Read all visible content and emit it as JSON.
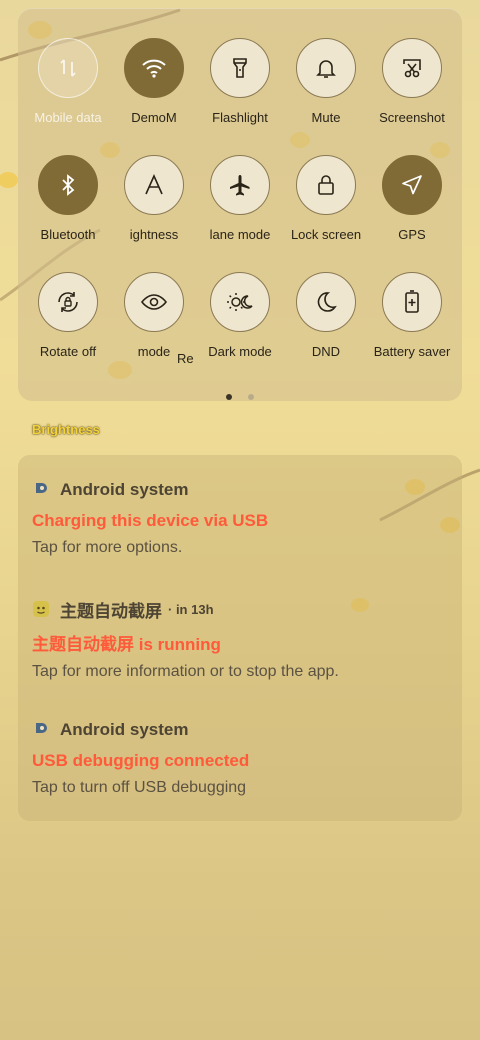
{
  "quick_settings": {
    "tiles": [
      {
        "label": "Mobile data",
        "icon": "mobile-data-icon",
        "state": "disabled"
      },
      {
        "label": "DemoM",
        "icon": "wifi-icon",
        "state": "on"
      },
      {
        "label": "Flashlight",
        "icon": "flashlight-icon",
        "state": "off"
      },
      {
        "label": "Mute",
        "icon": "bell-icon",
        "state": "off"
      },
      {
        "label": "Screenshot",
        "icon": "screenshot-icon",
        "state": "off"
      },
      {
        "label": "Bluetooth",
        "icon": "bluetooth-icon",
        "state": "on"
      },
      {
        "label": "ightness",
        "icon": "auto-brightness-icon",
        "state": "off"
      },
      {
        "label": "lane mode",
        "icon": "airplane-icon",
        "state": "off"
      },
      {
        "label": "Lock screen",
        "icon": "lock-icon",
        "state": "off"
      },
      {
        "label": "GPS",
        "icon": "location-arrow-icon",
        "state": "on"
      },
      {
        "label": "Rotate off",
        "icon": "rotate-lock-icon",
        "state": "off"
      },
      {
        "label": "mode",
        "icon": "eye-icon",
        "state": "off"
      },
      {
        "label": "Dark mode",
        "icon": "dark-mode-icon",
        "state": "off"
      },
      {
        "label": "DND",
        "icon": "moon-icon",
        "state": "off"
      },
      {
        "label": "Battery saver",
        "icon": "battery-plus-icon",
        "state": "off"
      }
    ],
    "partial_label": "Re",
    "page_count": 2,
    "active_page": 1
  },
  "brightness": {
    "label": "Brightness"
  },
  "notifications": [
    {
      "app": "Android system",
      "when": "",
      "title": "Charging this device via USB",
      "body": "Tap for more options.",
      "icon": "android-p-icon"
    },
    {
      "app": "主题自动截屏",
      "when": "· in 13h",
      "title": "主题自动截屏 is running",
      "body": "Tap for more information or to stop the app.",
      "icon": "app-screenshot-icon"
    },
    {
      "app": "Android system",
      "when": "",
      "title": "USB debugging connected",
      "body": "Tap to turn off USB debugging",
      "icon": "android-p-icon"
    }
  ],
  "colors": {
    "accent_on": "#806a36",
    "notif_title": "#ff5a3a"
  }
}
